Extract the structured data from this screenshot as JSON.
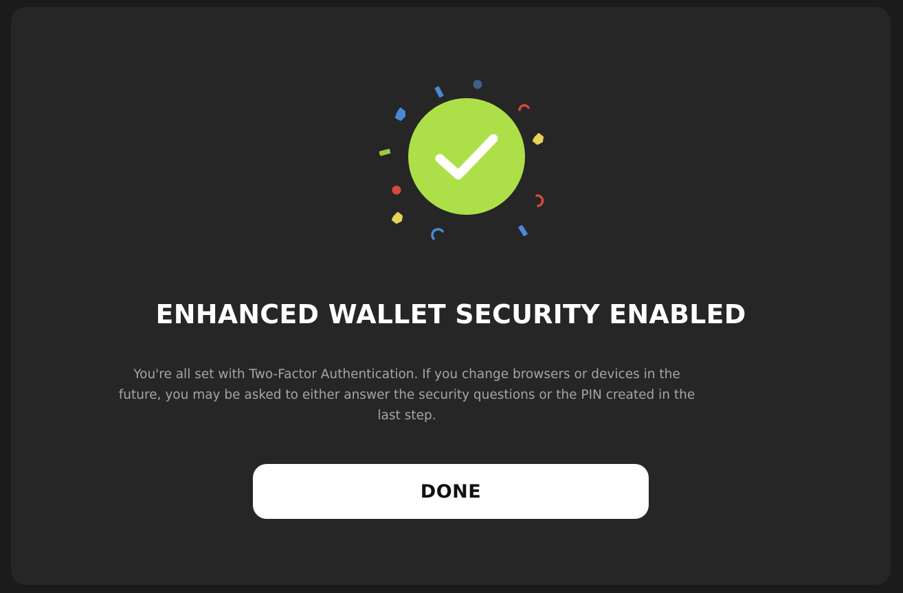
{
  "dialog": {
    "title": "ENHANCED WALLET SECURITY ENABLED",
    "message": "You're all set with Two-Factor Authentication. If you change browsers or devices in the future, you may be asked to either answer the security questions or the PIN created in the last step.",
    "done_label": "DONE"
  },
  "illustration": {
    "icon": "check-circle-icon",
    "circle_color": "#ade048",
    "check_color": "#ffffff",
    "confetti_colors": [
      "#4a88d6",
      "#d44a3f",
      "#e4d25a",
      "#9fc93d",
      "#3c5f8c"
    ]
  },
  "colors": {
    "backdrop": "#1b1b1b",
    "modal_background": "#262626",
    "title": "#ffffff",
    "message": "#a5a5a5",
    "button_background": "#ffffff",
    "button_text": "#111111"
  }
}
